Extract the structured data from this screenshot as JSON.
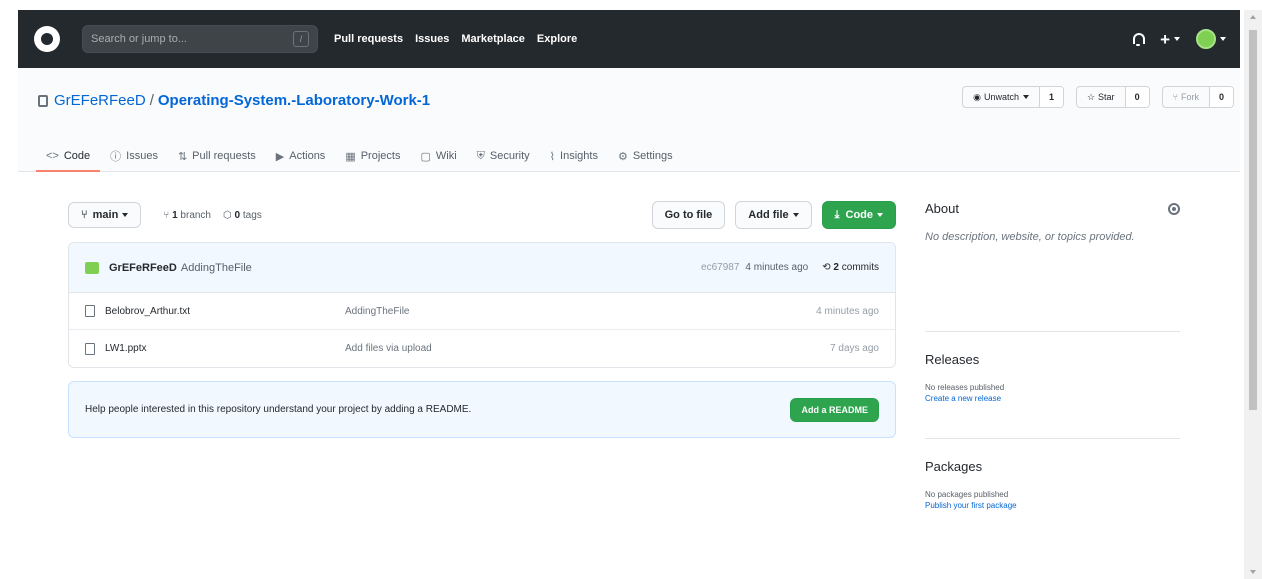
{
  "header": {
    "search_placeholder": "Search or jump to...",
    "slash_key": "/",
    "nav": [
      "Pull requests",
      "Issues",
      "Marketplace",
      "Explore"
    ],
    "plus": "+"
  },
  "repo": {
    "owner": "GrEFeRFeeD",
    "separator": "/",
    "name": "Operating-System.-Laboratory-Work-1",
    "watch_label": "Unwatch",
    "watch_count": "1",
    "star_label": "Star",
    "star_count": "0",
    "fork_label": "Fork",
    "fork_count": "0"
  },
  "tabs": [
    {
      "icon": "<>",
      "label": "Code"
    },
    {
      "icon": "ⓘ",
      "label": "Issues"
    },
    {
      "icon": "⇅",
      "label": "Pull requests"
    },
    {
      "icon": "▶",
      "label": "Actions"
    },
    {
      "icon": "▦",
      "label": "Projects"
    },
    {
      "icon": "▢",
      "label": "Wiki"
    },
    {
      "icon": "⛨",
      "label": "Security"
    },
    {
      "icon": "⌇",
      "label": "Insights"
    },
    {
      "icon": "⚙",
      "label": "Settings"
    }
  ],
  "toolbar": {
    "branch": "main",
    "branches_count": "1",
    "branches_label": "branch",
    "tags_count": "0",
    "tags_label": "tags",
    "go_to_file": "Go to file",
    "add_file": "Add file",
    "code": "Code"
  },
  "commit": {
    "author": "GrEFeRFeeD",
    "message": "AddingTheFile",
    "sha": "ec67987",
    "time": "4 minutes ago",
    "commits_count": "2",
    "commits_label": "commits"
  },
  "files": [
    {
      "name": "Belobrov_Arthur.txt",
      "message": "AddingTheFile",
      "age": "4 minutes ago"
    },
    {
      "name": "LW1.pptx",
      "message": "Add files via upload",
      "age": "7 days ago"
    }
  ],
  "readme": {
    "text": "Help people interested in this repository understand your project by adding a README.",
    "button": "Add a README"
  },
  "sidebar": {
    "about_title": "About",
    "about_desc": "No description, website, or topics provided.",
    "releases_title": "Releases",
    "releases_sub": "No releases published",
    "releases_link": "Create a new release",
    "packages_title": "Packages",
    "packages_sub": "No packages published",
    "packages_link": "Publish your first package"
  },
  "colors": {
    "header_bg": "#24292e",
    "link": "#0366d6",
    "green": "#2ea44f",
    "active_tab": "#f9826c"
  }
}
